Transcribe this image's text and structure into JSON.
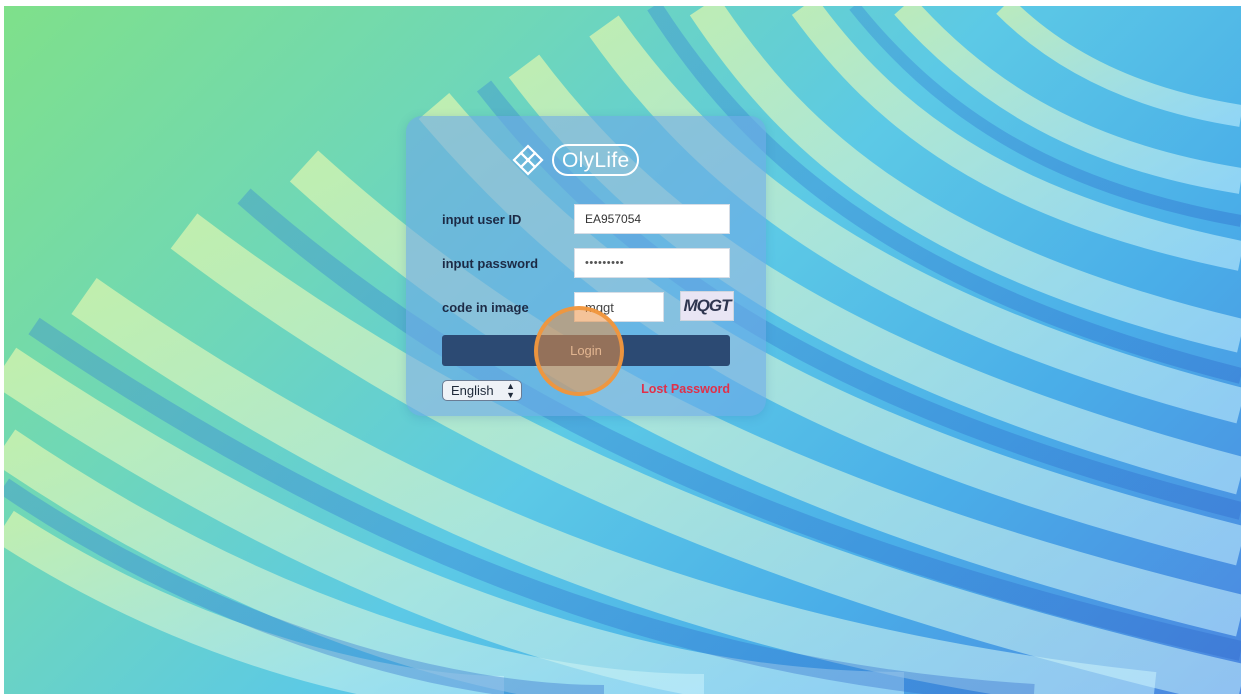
{
  "brand": {
    "logo_text": "OlyLife",
    "logo_icon": "olylife-flower-icon"
  },
  "form": {
    "user_id": {
      "label": "input user ID",
      "value": "EA957054"
    },
    "password": {
      "label": "input password",
      "value": "•••••••••"
    },
    "code": {
      "label": "code in image",
      "value": "mqgt",
      "captcha_text": "MQGT"
    },
    "login_label": "Login",
    "language_selected": "English",
    "lost_password_label": "Lost Password"
  },
  "colors": {
    "login_button": "#2c4a73",
    "lost_password": "#e0304a",
    "click_indicator": "#f0963c",
    "background_start": "#7fe08a",
    "background_end": "#4b86e0"
  }
}
